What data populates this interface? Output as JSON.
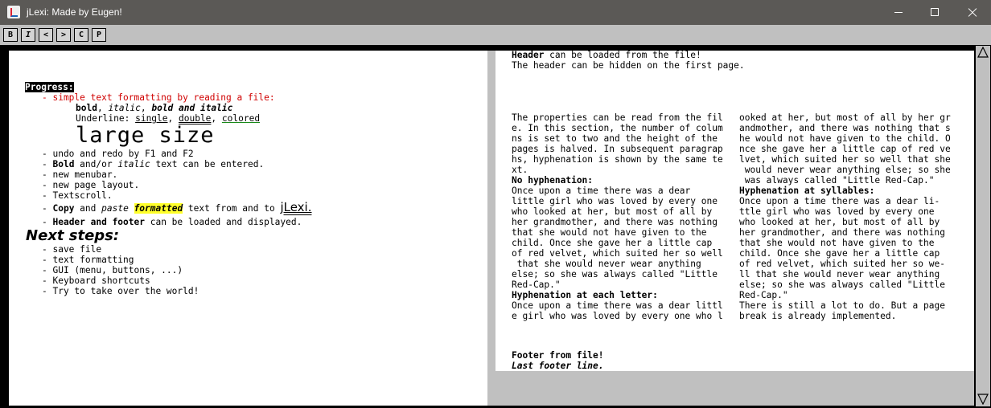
{
  "window": {
    "title": "jLexi: Made by Eugen!"
  },
  "toolbar": {
    "buttons": [
      "B",
      "I",
      "<",
      ">",
      "C",
      "P"
    ]
  },
  "left": {
    "progress_label": "Progress:",
    "item1": "- simple text formatting by reading a file:",
    "fmt_bold": "bold",
    "fmt_sep1": ", ",
    "fmt_italic": "italic",
    "fmt_sep2": ", ",
    "fmt_bolditalic": "bold and italic",
    "underline_prefix": "Underline: ",
    "ul_single": "single",
    "ul_sep1": ", ",
    "ul_double": "double",
    "ul_sep2": ", ",
    "ul_colored": "colored",
    "large_text": "large size",
    "undo_line": "- undo and redo by F1 and F2",
    "bold_line_dash": "- ",
    "bold_line_bold": "Bold",
    "bold_line_mid": " and/or ",
    "bold_line_italic": "italic",
    "bold_line_end": " text can be entered.",
    "menubar_line": "- new menubar.",
    "pagelayout_line": "- new page layout.",
    "textscroll_line": "- Textscroll.",
    "copy_dash": "- ",
    "copy_word": "Copy",
    "copy_and": " and ",
    "paste_word": "paste",
    "formatted_word": "formatted",
    "copy_rest": " text from and to ",
    "jlexi": "jLexi.",
    "header_dash": "- ",
    "header_bold": "Header and footer",
    "header_rest": " can be loaded and displayed.",
    "next_steps": "Next steps:",
    "steps": [
      "- save file",
      "- text formatting",
      "- GUI (menu, buttons, ...)",
      "- Keyboard shortcuts",
      "- Try to take over the world!"
    ]
  },
  "right": {
    "header_bold": "Header",
    "header_rest": " can be loaded from the file!",
    "header_line2": "The header can be hidden on the first page.",
    "col1": [
      "The properties can be read from the fil",
      "e. In this section, the number of colum",
      "ns is set to two and the height of the",
      "pages is halved. In subsequent paragrap",
      "hs, hyphenation is shown by the same te",
      "xt."
    ],
    "no_hyph": "No hyphenation:",
    "col1b": [
      "Once upon a time there was a dear",
      "little girl who was loved by every one",
      "who looked at her, but most of all by",
      "her grandmother, and there was nothing",
      "that she would not have given to the",
      "child. Once she gave her a little cap",
      "of red velvet, which suited her so well",
      " that she would never wear anything",
      "else; so she was always called \"Little",
      "Red-Cap.\""
    ],
    "hyph_letter": "Hyphenation at each letter:",
    "col1c": [
      "Once upon a time there was a dear littl",
      "e girl who was loved by every one who l"
    ],
    "col2": [
      "ooked at her, but most of all by her gr",
      "andmother, and there was nothing that s",
      "he would not have given to the child. O",
      "nce she gave her a little cap of red ve",
      "lvet, which suited her so well that she",
      " would never wear anything else; so she",
      " was always called \"Little Red-Cap.\""
    ],
    "hyph_syll": "Hyphenation at syllables:",
    "col2b": [
      "Once upon a time there was a dear li-",
      "ttle girl who was loved by every one",
      "who looked at her, but most of all by",
      "her grandmother, and there was nothing",
      "that she would not have given to the",
      "child. Once she gave her a little cap",
      "of red velvet, which suited her so we-",
      "ll that she would never wear anything",
      "else; so she was always called \"Little",
      "Red-Cap.\"",
      "There is still a lot to do. But a page",
      "break is already implemented."
    ],
    "footer1": "Footer from file!",
    "footer2": "Last footer line."
  }
}
